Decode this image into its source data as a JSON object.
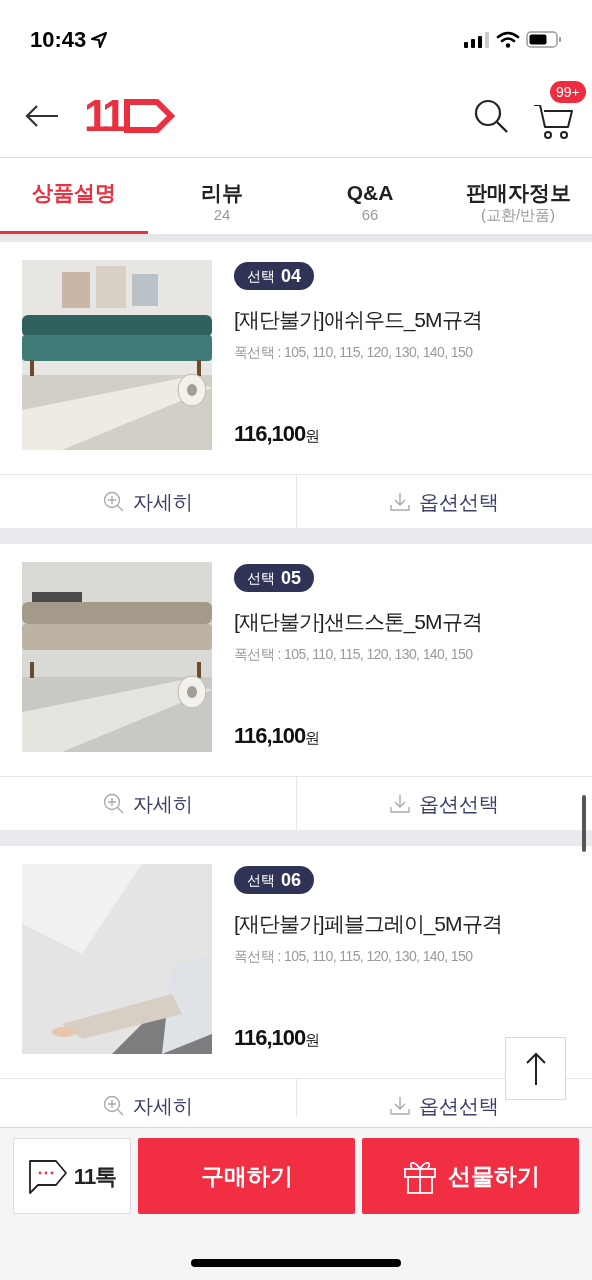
{
  "status_bar": {
    "time": "10:43"
  },
  "header": {
    "logo": "11",
    "cart_badge": "99+"
  },
  "tabs": [
    {
      "label": "상품설명",
      "selected": true
    },
    {
      "label": "리뷰",
      "sub": "24",
      "selected": false
    },
    {
      "label": "Q&A",
      "sub": "66",
      "selected": false
    },
    {
      "label": "판매자정보",
      "sub": "(교환/반품)",
      "selected": false
    }
  ],
  "products": [
    {
      "badge_label": "선택",
      "badge_number": "04",
      "title": "[재단불가]애쉬우드_5M규격",
      "widths": "폭선택 : 105, 110, 115, 120, 130, 140, 150",
      "price": "116,100",
      "currency": "원",
      "actions": [
        "자세히",
        "옵션선택"
      ]
    },
    {
      "badge_label": "선택",
      "badge_number": "05",
      "title": "[재단불가]샌드스톤_5M규격",
      "widths": "폭선택 : 105, 110, 115, 120, 130, 140, 150",
      "price": "116,100",
      "currency": "원",
      "actions": [
        "자세히",
        "옵션선택"
      ]
    },
    {
      "badge_label": "선택",
      "badge_number": "06",
      "title": "[재단불가]페블그레이_5M규격",
      "widths": "폭선택 : 105, 110, 115, 120, 130, 140, 150",
      "price": "116,100",
      "currency": "원",
      "actions": [
        "자세히",
        "옵션선택"
      ]
    }
  ],
  "bottom_bar": {
    "chat": "11톡",
    "buy": "구매하기",
    "gift": "선물하기"
  }
}
